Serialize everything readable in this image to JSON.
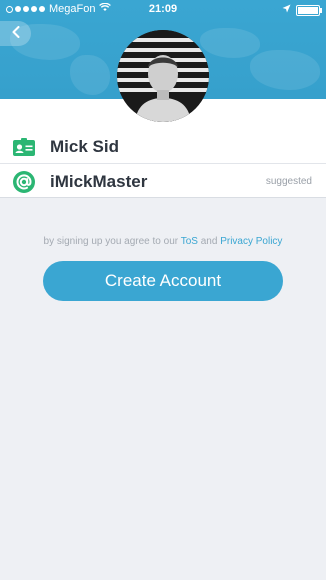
{
  "status": {
    "carrier": "MegaFon",
    "time": "21:09"
  },
  "profile": {
    "name": "Mick Sid",
    "username": "iMickMaster",
    "username_hint": "suggested"
  },
  "terms": {
    "prefix": "by signing up you agree to our",
    "tos": "ToS",
    "and": "and",
    "privacy": "Privacy Policy"
  },
  "actions": {
    "create_account": "Create Account"
  },
  "colors": {
    "accent": "#3aa6d2",
    "name_icon": "#2bb673",
    "background": "#eef0f4"
  },
  "icons": {
    "back": "chevron-left-icon",
    "name": "id-card-icon",
    "username": "at-sign-icon"
  }
}
